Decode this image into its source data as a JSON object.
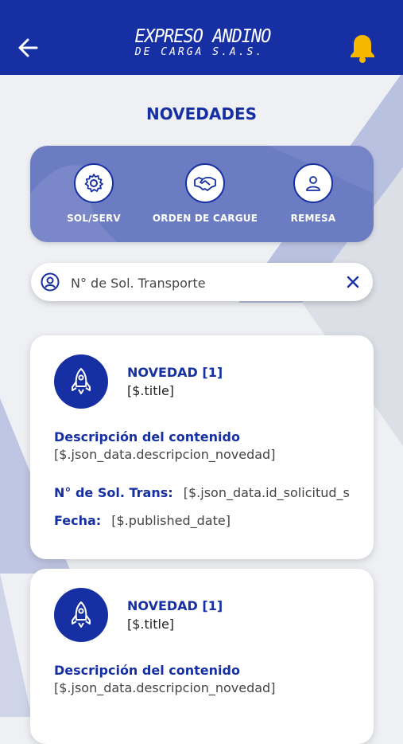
{
  "header": {
    "logo_line1": "EXPRESO ANDINO",
    "logo_line2": "DE CARGA S.A.S.",
    "back_icon": "arrow-left-icon",
    "notifications_icon": "bell-icon",
    "bar_color": "#1630a3",
    "bell_color": "#f5b800"
  },
  "page_title": "NOVEDADES",
  "menu": {
    "items": [
      {
        "label": "SOL/SERV",
        "icon": "gear-icon"
      },
      {
        "label": "ORDEN DE CARGUE",
        "icon": "handshake-icon"
      },
      {
        "label": "REMESA",
        "icon": "user-icon"
      }
    ]
  },
  "search": {
    "placeholder": "N° de Sol. Transporte",
    "value": "",
    "icon": "user-circle-icon",
    "clear_icon": "close-icon"
  },
  "cards": [
    {
      "title": "NOVEDAD [1]",
      "subtitle": "[$.title]",
      "desc_label": "Descripción del contenido",
      "desc_value": "[$.json_data.descripcion_novedad]",
      "sol_label": "N° de Sol. Trans:",
      "sol_value": "[$.json_data.id_solicitud_s",
      "fecha_label": "Fecha:",
      "fecha_value": "[$.published_date]",
      "icon": "rocket-icon"
    },
    {
      "title": "NOVEDAD [1]",
      "subtitle": "[$.title]",
      "desc_label": "Descripción del contenido",
      "desc_value": "[$.json_data.descripcion_novedad]",
      "icon": "rocket-icon"
    }
  ]
}
